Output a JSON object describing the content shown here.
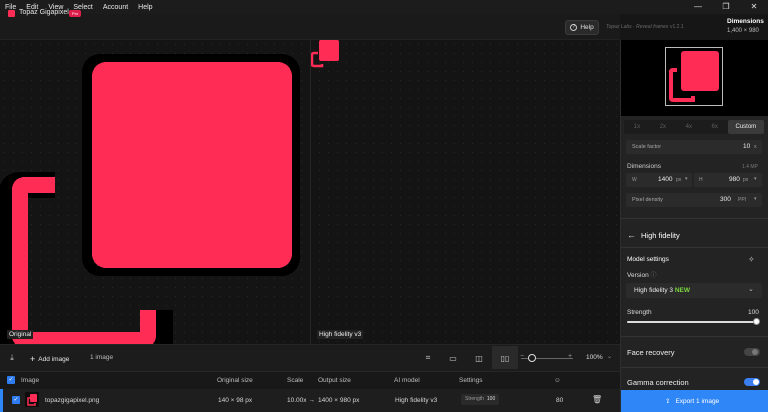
{
  "menu": [
    "File",
    "Edit",
    "View",
    "Select",
    "Account",
    "Help"
  ],
  "app": {
    "name": "Topaz Gigapixel",
    "badge": "Pro",
    "help_label": "Help",
    "tagline": "Topaz Labs · Reveal frames",
    "version": "v1.2.1"
  },
  "dimensions_header": {
    "label": "Dimensions",
    "value": "1,400 × 980"
  },
  "canvas": {
    "left_label": "Original",
    "right_label": "High fidelity v3"
  },
  "toolbar": {
    "add_image": "Add image",
    "image_count": "1 image",
    "zoom": "100%"
  },
  "list": {
    "headers": {
      "image": "Image",
      "original_size": "Original size",
      "scale": "Scale",
      "output_size": "Output size",
      "ai_model": "AI model",
      "settings": "Settings"
    },
    "row": {
      "filename": "topazgigapixel.png",
      "original_size": "140 × 98 px",
      "scale": "10.00x →",
      "output_size": "1400 × 980 px",
      "ai_model": "High fidelity v3",
      "strength_label": "Strength",
      "strength_value": "100",
      "score": "80"
    }
  },
  "panel": {
    "scale_tabs": [
      "1x",
      "2x",
      "4x",
      "6x",
      "Custom"
    ],
    "scale_factor_label": "Scale factor",
    "scale_factor_value": "10",
    "dimensions_label": "Dimensions",
    "dimensions_mp": "1.4 MP",
    "w_label": "W",
    "w_value": "1400",
    "w_unit": "px",
    "h_label": "H",
    "h_value": "980",
    "h_unit": "px",
    "pixel_density_label": "Pixel density",
    "pixel_density_value": "300",
    "pixel_density_unit": "PPI",
    "model_title": "High fidelity",
    "model_settings_label": "Model settings",
    "version_label": "Version",
    "version_value": "High fidelity 3",
    "version_new": "NEW",
    "strength_label": "Strength",
    "strength_value": "100",
    "strength_level": 1.0,
    "face_recovery_label": "Face recovery",
    "gamma_label": "Gamma correction",
    "export_label": "Export 1 image"
  },
  "colors": {
    "accent": "#ff2d55",
    "primary": "#2f86f6",
    "new_badge": "#7ad63c"
  }
}
